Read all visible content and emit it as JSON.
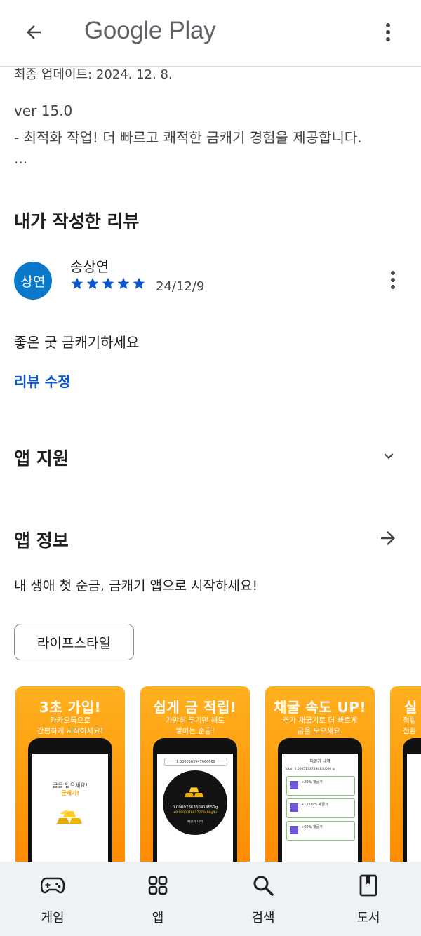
{
  "header": {
    "title": "Google Play",
    "back_icon": "arrow-left-icon",
    "more_icon": "more-vert-icon"
  },
  "whats_new": {
    "updated": "최종 업데이트: 2024. 12. 8.",
    "version": "ver 15.0",
    "note": "- 최적화 작업! 더 빠르고 쾌적한 금캐기 경험을 제공합니다.",
    "ellipsis": "..."
  },
  "my_review": {
    "heading": "내가 작성한 리뷰",
    "avatar_text": "상연",
    "reviewer": "송상연",
    "rating": 5,
    "date": "24/12/9",
    "text": "좋은 굿 금캐기하세요",
    "edit_label": "리뷰 수정",
    "accent": "#0b57d0"
  },
  "app_support": {
    "heading": "앱 지원"
  },
  "app_info": {
    "heading": "앱 정보",
    "description": "내 생애 첫 순금, 금캐기 앱으로 시작하세요!",
    "category": "라이프스타일"
  },
  "screenshots": [
    {
      "title": "3초 가입!",
      "subtitle_1": "카카오톡으로",
      "subtitle_2": "간편하게 시작하세요!",
      "screen_line_1": "금을 얻으세요!",
      "screen_line_2": "금캐기!"
    },
    {
      "title": "쉽게 금 적립!",
      "subtitle_1": "가만히 두기만 해도",
      "subtitle_2": "쌓이는 순금!",
      "bar_value": "1.0000569547666669",
      "gold_value": "0.0000786360414651g",
      "gold_rate": "+0.0000078657279498g/hr",
      "button": "채굴기 내역"
    },
    {
      "title": "채굴 속도 UP!",
      "subtitle_1": "추가 채굴기로 더 빠르게",
      "subtitle_2": "금을 모으세요.",
      "list_title": "채굴기 내역",
      "total": "Total: 0.00051337498130092 g",
      "card_1": "+20% 채굴기",
      "card_2": "+1,000% 채굴기",
      "card_3": "+60% 채굴기"
    },
    {
      "title": "실",
      "subtitle_1": "적립",
      "subtitle_2": "전환"
    }
  ],
  "bottom_nav": [
    {
      "label": "게임",
      "icon": "gamepad-icon"
    },
    {
      "label": "앱",
      "icon": "apps-grid-icon"
    },
    {
      "label": "검색",
      "icon": "search-icon"
    },
    {
      "label": "도서",
      "icon": "book-icon"
    }
  ]
}
